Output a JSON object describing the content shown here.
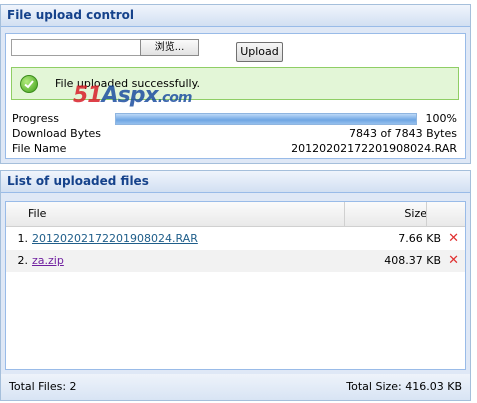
{
  "upload_panel": {
    "title": "File upload control",
    "browse_label": "浏览...",
    "upload_label": "Upload",
    "success_message": "File uploaded successfully.",
    "progress": {
      "label": "Progress",
      "value_text": "100%",
      "percent": 100
    },
    "download_bytes": {
      "label": "Download Bytes",
      "value": "7843 of 7843 Bytes"
    },
    "file_name": {
      "label": "File Name",
      "value": "20120202172201908024.RAR"
    }
  },
  "watermark": {
    "part1": "51",
    "part2": "Aspx",
    "part3": ".com"
  },
  "list_panel": {
    "title": "List of uploaded files",
    "columns": {
      "file": "File",
      "size": "Size"
    },
    "rows": [
      {
        "num": "1.",
        "name": "20120202172201908024.RAR",
        "size": "7.66 KB"
      },
      {
        "num": "2.",
        "name": "za.zip",
        "size": "408.37 KB"
      }
    ],
    "total_files": "Total Files: 2",
    "total_size": "Total Size: 416.03 KB"
  },
  "colors": {
    "header_text": "#15428b",
    "success_bg": "#e3f6d7",
    "delete": "#e03030"
  }
}
